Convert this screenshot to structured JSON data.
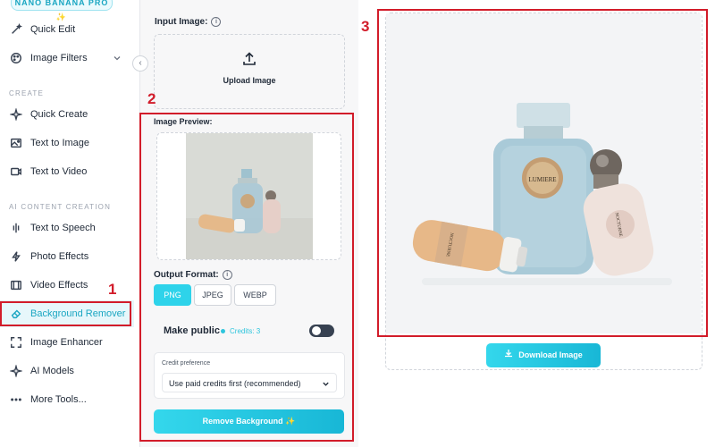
{
  "badge": "NANO BANANA PRO ✨",
  "sidebar": {
    "items_top": [
      {
        "label": "Quick Edit",
        "icon": "magic-wand-icon"
      },
      {
        "label": "Image Filters",
        "icon": "palette-icon"
      }
    ],
    "section_create": "CREATE",
    "items_create": [
      {
        "label": "Quick Create",
        "icon": "sparkle-icon"
      },
      {
        "label": "Text to Image",
        "icon": "image-icon"
      },
      {
        "label": "Text to Video",
        "icon": "video-icon"
      }
    ],
    "section_ai": "AI CONTENT CREATION",
    "items_ai": [
      {
        "label": "Text to Speech",
        "icon": "speech-icon"
      },
      {
        "label": "Photo Effects",
        "icon": "lightning-icon"
      },
      {
        "label": "Video Effects",
        "icon": "film-icon"
      },
      {
        "label": "Background Remover",
        "icon": "eraser-icon"
      },
      {
        "label": "Image Enhancer",
        "icon": "enhance-icon"
      },
      {
        "label": "AI Models",
        "icon": "sparkle-icon"
      },
      {
        "label": "More Tools...",
        "icon": "dots-icon"
      }
    ]
  },
  "middle": {
    "input_label": "Input Image:",
    "upload_label": "Upload Image",
    "preview_label": "Image Preview:",
    "output_format_label": "Output Format:",
    "formats": [
      "PNG",
      "JPEG",
      "WEBP"
    ],
    "selected_format": "PNG",
    "make_public_label": "Make public",
    "credits_text": "Credits: 3",
    "make_public_on": false,
    "credit_pref_label": "Credit preference",
    "credit_pref_value": "Use paid credits first (recommended)",
    "remove_btn": "Remove Background ✨"
  },
  "right": {
    "download_btn": "Download Image"
  },
  "product_labels": {
    "center_bottle": "LUMIERE",
    "right_bottle": "NOCTURNE",
    "left_bottle": "NOCTURNE"
  },
  "annotations": [
    "1",
    "2",
    "3"
  ],
  "colors": {
    "accent": "#2ed3ea",
    "annotation": "#d21c2a"
  }
}
